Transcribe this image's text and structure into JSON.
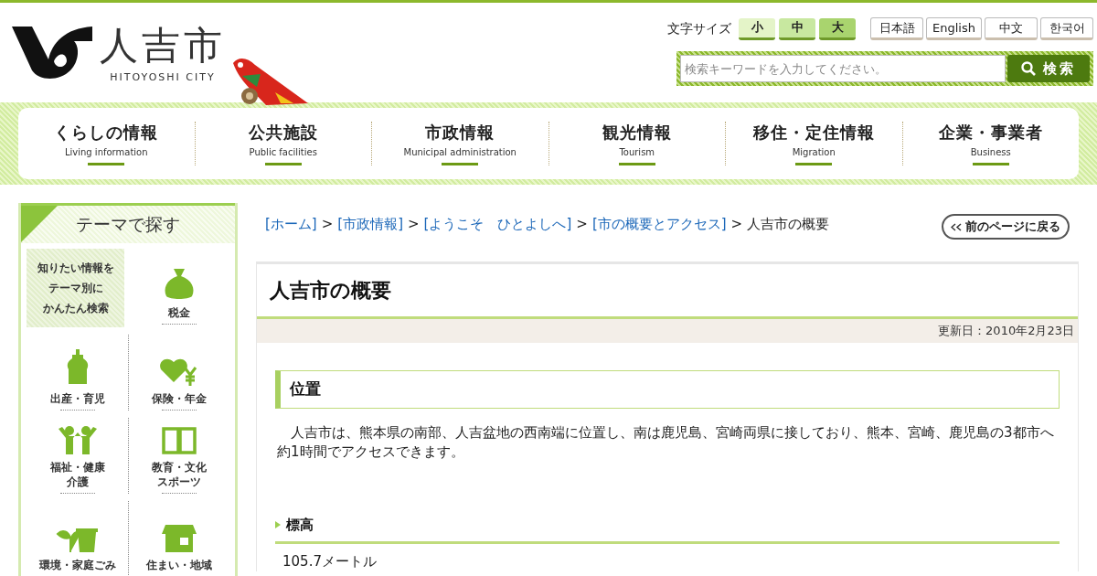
{
  "header": {
    "logo_text": "人吉市",
    "logo_subtitle": "HITOYOSHI CITY",
    "font_size": {
      "label": "文字サイズ",
      "options": [
        {
          "label": "小",
          "color": "#e4f4c8"
        },
        {
          "label": "中",
          "color": "#c8e8a0"
        },
        {
          "label": "大",
          "color": "#a9d46e"
        }
      ]
    },
    "languages": [
      "日本語",
      "English",
      "中文",
      "한국어"
    ],
    "search": {
      "placeholder": "検索キーワードを入力してください。",
      "button": "検索"
    }
  },
  "nav": [
    {
      "label": "くらしの情報",
      "sub": "Living information"
    },
    {
      "label": "公共施設",
      "sub": "Public facilities"
    },
    {
      "label": "市政情報",
      "sub": "Municipal administration"
    },
    {
      "label": "観光情報",
      "sub": "Tourism"
    },
    {
      "label": "移住・定住情報",
      "sub": "Migration"
    },
    {
      "label": "企業・事業者",
      "sub": "Business"
    }
  ],
  "sidebar": {
    "title": "テーマで探す",
    "items": [
      {
        "kind": "intro",
        "lines": [
          "知りたい情報を",
          "テーマ別に",
          "かんたん検索"
        ]
      },
      {
        "kind": "theme",
        "lines": [
          "税金"
        ]
      },
      {
        "kind": "theme",
        "lines": [
          "出産・育児"
        ]
      },
      {
        "kind": "theme",
        "lines": [
          "保険・年金"
        ]
      },
      {
        "kind": "theme",
        "lines": [
          "福祉・健康",
          "介護"
        ]
      },
      {
        "kind": "theme",
        "lines": [
          "教育・文化",
          "スポーツ"
        ]
      },
      {
        "kind": "theme",
        "lines": [
          "環境・家庭ごみ"
        ]
      },
      {
        "kind": "theme",
        "lines": [
          "住まい・地域"
        ]
      }
    ]
  },
  "breadcrumb": {
    "links": [
      "[ホーム]",
      "[市政情報]",
      "[ようこそ　ひとよしへ]",
      "[市の概要とアクセス]"
    ],
    "separators": [
      ">",
      ">",
      ">",
      ">"
    ],
    "current": "人吉市の概要"
  },
  "back_button": "前のページに戻る",
  "page": {
    "title": "人吉市の概要",
    "updated": "更新日：2010年2月23日",
    "section": "位置",
    "body": "人吉市は、熊本県の南部、人吉盆地の西南端に位置し、南は鹿児島、宮崎両県に接しており、熊本、宮崎、鹿児島の3都市へ約1時間でアクセスできます。",
    "subsection": "標高",
    "subsection_text": "105.7メートル"
  }
}
